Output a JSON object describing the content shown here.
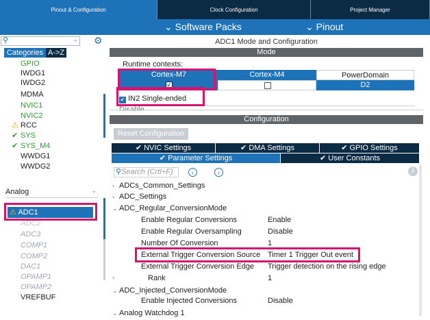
{
  "top_tabs": [
    "Pinout & Configuration",
    "Clock Configuration",
    "Project Manager"
  ],
  "subbar": {
    "software_packs": "⌄ Software Packs",
    "pinout": "⌄ Pinout"
  },
  "left": {
    "search_icon": "search-icon",
    "search_value": "",
    "tabs": [
      "Categories",
      "A->Z"
    ],
    "system_items": [
      {
        "label": "GPIO",
        "color": "green",
        "prefix": ""
      },
      {
        "label": "IWDG1",
        "color": "dark",
        "prefix": ""
      },
      {
        "label": "IWDG2",
        "color": "dark",
        "prefix": ""
      },
      {
        "label": "MDMA",
        "color": "dark",
        "prefix": ""
      },
      {
        "label": "NVIC1",
        "color": "green",
        "prefix": ""
      },
      {
        "label": "NVIC2",
        "color": "green",
        "prefix": ""
      },
      {
        "label": "RCC",
        "color": "dark",
        "prefix": "⚠"
      },
      {
        "label": "SYS",
        "color": "green",
        "prefix": "✔"
      },
      {
        "label": "SYS_M4",
        "color": "green",
        "prefix": "✔"
      },
      {
        "label": "WWDG1",
        "color": "dark",
        "prefix": ""
      },
      {
        "label": "WWDG2",
        "color": "dark",
        "prefix": ""
      }
    ],
    "analog_header": "Analog",
    "analog_selected": "ADC1",
    "analog_items": [
      "ADC2",
      "ADC3",
      "COMP1",
      "COMP2",
      "DAC1",
      "OPAMP1",
      "OPAMP2"
    ],
    "analog_last": "VREFBUF"
  },
  "right": {
    "title": "ADC1 Mode and Configuration",
    "mode_header": "Mode",
    "runtime_label": "Runtime contexts:",
    "contexts": [
      "Cortex-M7",
      "Cortex-M4",
      "PowerDomain"
    ],
    "context_checks": [
      true,
      false
    ],
    "power_value": "D2",
    "in2_label": "IN2 Single-ended",
    "in2_checked": true,
    "partial_label": "Disable",
    "config_header": "Configuration",
    "reset_button": "Reset Configuration",
    "tabs_row1": [
      "NVIC Settings",
      "DMA Settings",
      "GPIO Settings"
    ],
    "tabs_row2": [
      "Parameter Settings",
      "User Constants"
    ],
    "search_placeholder": "Search (Crtl+F)",
    "params": {
      "common": "ADCs_Common_Settings",
      "adc_settings": "ADC_Settings",
      "regular": "ADC_Regular_ConversionMode",
      "rows": [
        {
          "key": "Enable Regular Conversions",
          "value": "Enable"
        },
        {
          "key": "Enable Regular Oversampling",
          "value": "Disable"
        },
        {
          "key": "Number Of Conversion",
          "value": "1"
        },
        {
          "key": "External Trigger Conversion Source",
          "value": "Timer 1 Trigger Out event"
        },
        {
          "key": "External Trigger Conversion Edge",
          "value": "Trigger detection on the rising edge"
        }
      ],
      "rank_key": "Rank",
      "rank_value": "1",
      "injected": "ADC_Injected_ConversionMode",
      "injected_key": "Enable Injected Conversions",
      "injected_value": "Disable",
      "watchdog": "Analog Watchdog 1"
    }
  },
  "colors": {
    "accent": "#1e73b8",
    "dark_navy": "#0b2a44",
    "highlight": "#d4146f",
    "header_grey": "#5f6468"
  }
}
